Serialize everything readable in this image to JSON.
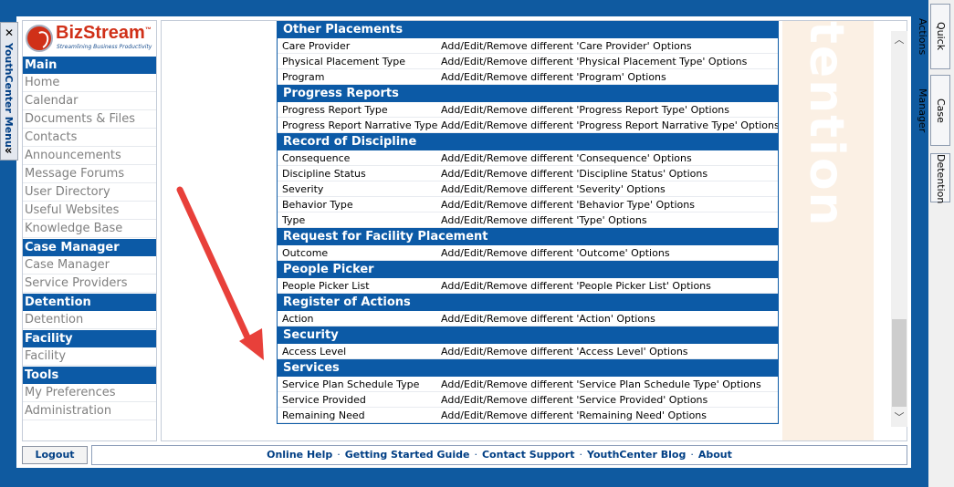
{
  "menu_tab": {
    "close": "✕",
    "label": "YouthCenter Menu",
    "collapse": "«"
  },
  "logo": {
    "name": "BizStream",
    "tagline": "Streamlining Business Productivity",
    "trademark": "™"
  },
  "sidebar": {
    "sections": [
      {
        "title": "Main",
        "items": [
          "Home",
          "Calendar",
          "Documents & Files",
          "Contacts",
          "Announcements",
          "Message Forums",
          "User Directory",
          "Useful Websites",
          "Knowledge Base"
        ]
      },
      {
        "title": "Case Manager",
        "items": [
          "Case Manager",
          "Service Providers"
        ]
      },
      {
        "title": "Detention",
        "items": [
          "Detention"
        ]
      },
      {
        "title": "Facility",
        "items": [
          "Facility"
        ]
      },
      {
        "title": "Tools",
        "items": [
          "My Preferences",
          "Administration"
        ]
      }
    ]
  },
  "watermark": {
    "text": "tention"
  },
  "options_groups": [
    {
      "title": "Other Placements",
      "rows": [
        {
          "name": "Care Provider",
          "desc": "Add/Edit/Remove different 'Care Provider' Options"
        },
        {
          "name": "Physical Placement Type",
          "desc": "Add/Edit/Remove different 'Physical Placement Type' Options"
        },
        {
          "name": "Program",
          "desc": "Add/Edit/Remove different 'Program' Options"
        }
      ]
    },
    {
      "title": "Progress Reports",
      "rows": [
        {
          "name": "Progress Report Type",
          "desc": "Add/Edit/Remove different 'Progress Report Type' Options"
        },
        {
          "name": "Progress Report Narrative Type",
          "desc": "Add/Edit/Remove different 'Progress Report Narrative Type' Options"
        }
      ]
    },
    {
      "title": "Record of Discipline",
      "rows": [
        {
          "name": "Consequence",
          "desc": "Add/Edit/Remove different 'Consequence' Options"
        },
        {
          "name": "Discipline Status",
          "desc": "Add/Edit/Remove different 'Discipline Status' Options"
        },
        {
          "name": "Severity",
          "desc": "Add/Edit/Remove different 'Severity' Options"
        },
        {
          "name": "Behavior Type",
          "desc": "Add/Edit/Remove different 'Behavior Type' Options"
        },
        {
          "name": "Type",
          "desc": "Add/Edit/Remove different 'Type' Options"
        }
      ]
    },
    {
      "title": "Request for Facility Placement",
      "rows": [
        {
          "name": "Outcome",
          "desc": "Add/Edit/Remove different 'Outcome' Options"
        }
      ]
    },
    {
      "title": "People Picker",
      "rows": [
        {
          "name": "People Picker List",
          "desc": "Add/Edit/Remove different 'People Picker List' Options"
        }
      ]
    },
    {
      "title": "Register of Actions",
      "rows": [
        {
          "name": "Action",
          "desc": "Add/Edit/Remove different 'Action' Options"
        }
      ]
    },
    {
      "title": "Security",
      "rows": [
        {
          "name": "Access Level",
          "desc": "Add/Edit/Remove different 'Access Level' Options"
        }
      ]
    },
    {
      "title": "Services",
      "rows": [
        {
          "name": "Service Plan Schedule Type",
          "desc": "Add/Edit/Remove different 'Service Plan Schedule Type' Options"
        },
        {
          "name": "Service Provided",
          "desc": "Add/Edit/Remove different 'Service Provided' Options"
        },
        {
          "name": "Remaining Need",
          "desc": "Add/Edit/Remove different 'Remaining Need' Options"
        }
      ]
    }
  ],
  "scrollbar": {
    "up": "︿",
    "down": "﹀"
  },
  "logout": "Logout",
  "footer_links": [
    "Online Help",
    "Getting Started Guide",
    "Contact Support",
    "YouthCenter Blog",
    "About"
  ],
  "footer_sep": "·",
  "right_tabs": [
    "Quick Actions",
    "Case Manager",
    "Detention"
  ],
  "colors": {
    "header_blue": "#0c5aa6",
    "background_blue": "#0f5aa0",
    "arrow_red": "#e8403a"
  }
}
